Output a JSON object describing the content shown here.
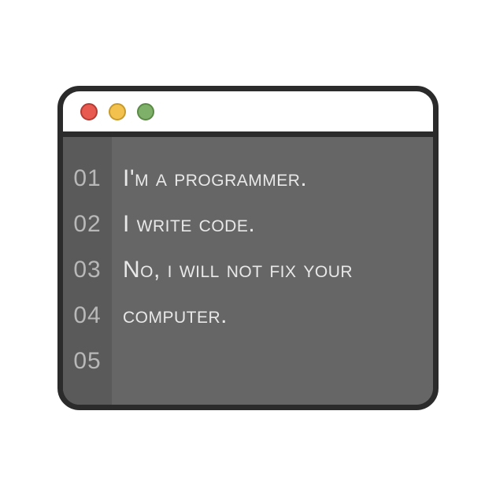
{
  "window": {
    "dots": [
      "red",
      "yellow",
      "green"
    ]
  },
  "editor": {
    "line_numbers": [
      "01",
      "02",
      "03",
      "04",
      "05"
    ],
    "lines": [
      "I'm a programmer.",
      "I write code.",
      "No, i will not fix your",
      "computer.",
      ""
    ]
  }
}
